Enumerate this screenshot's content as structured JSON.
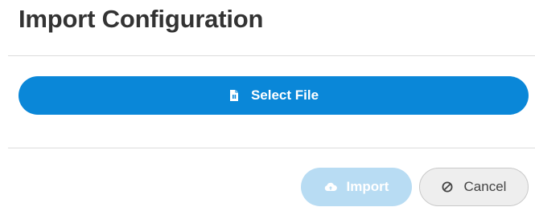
{
  "dialog": {
    "title": "Import Configuration"
  },
  "select_file": {
    "label": "Select File",
    "icon": "file-icon",
    "color": "#0a87d8"
  },
  "footer": {
    "import_label": "Import",
    "import_icon": "cloud-upload-icon",
    "import_color": "#b8dcf3",
    "import_state": "disabled",
    "cancel_label": "Cancel",
    "cancel_icon": "ban-icon"
  }
}
